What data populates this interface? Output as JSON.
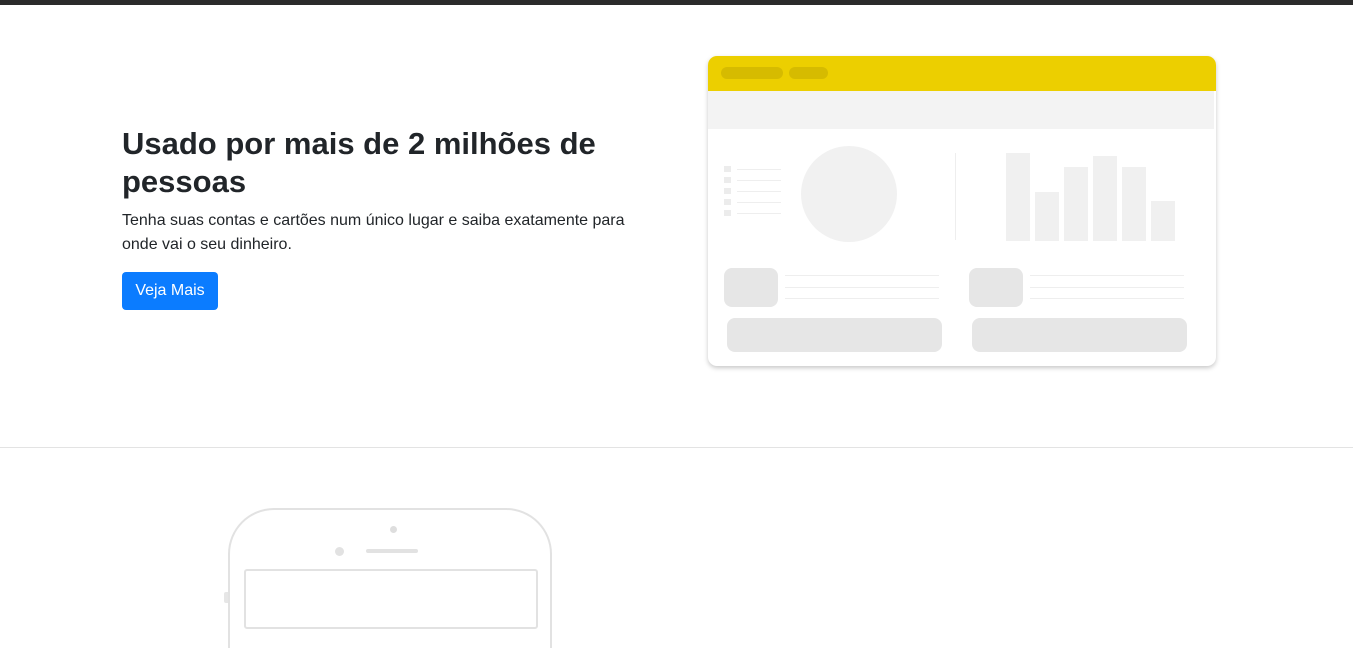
{
  "hero": {
    "title": "Usado por mais de 2 milhões de pessoas",
    "text": "Tenha suas contas e cartões num único lugar e saiba exatamente para onde vai o seu dinheiro.",
    "button_label": "Veja Mais"
  },
  "colors": {
    "accent": "#0b7cff",
    "dashboard_header": "#eccf00",
    "text": "#212529",
    "placeholder": "#e6e6e6"
  }
}
